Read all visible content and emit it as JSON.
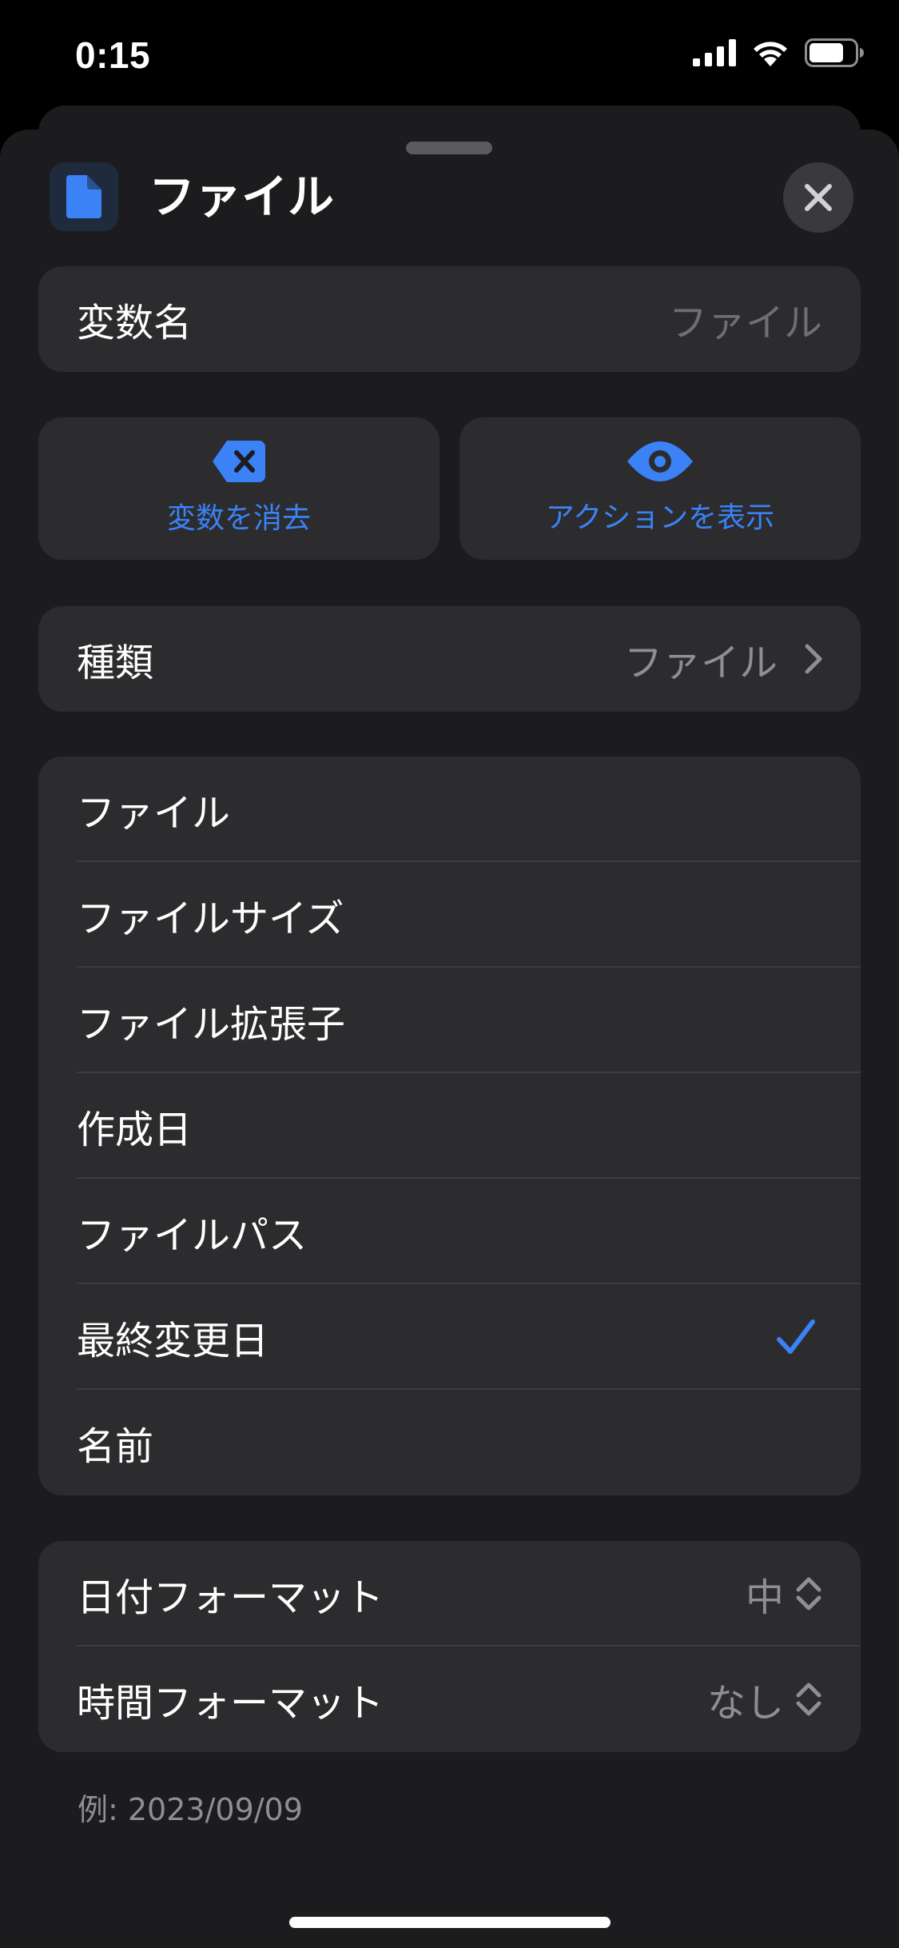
{
  "status_bar": {
    "time": "0:15"
  },
  "header": {
    "title": "ファイル",
    "icon": "document-icon"
  },
  "variable_name": {
    "label": "変数名",
    "placeholder": "ファイル"
  },
  "actions": {
    "clear_label": "変数を消去",
    "show_label": "アクションを表示"
  },
  "type_row": {
    "label": "種類",
    "value": "ファイル"
  },
  "properties": {
    "items": [
      {
        "label": "ファイル",
        "selected": false
      },
      {
        "label": "ファイルサイズ",
        "selected": false
      },
      {
        "label": "ファイル拡張子",
        "selected": false
      },
      {
        "label": "作成日",
        "selected": false
      },
      {
        "label": "ファイルパス",
        "selected": false
      },
      {
        "label": "最終変更日",
        "selected": true
      },
      {
        "label": "名前",
        "selected": false
      }
    ]
  },
  "format": {
    "date_label": "日付フォーマット",
    "date_value": "中",
    "time_label": "時間フォーマット",
    "time_value": "なし"
  },
  "example": "例: 2023/09/09",
  "colors": {
    "accent": "#3b82f6",
    "sheet_bg": "#1c1c1e",
    "card_bg": "#2c2c2e",
    "secondary_text": "#8e8e93"
  }
}
